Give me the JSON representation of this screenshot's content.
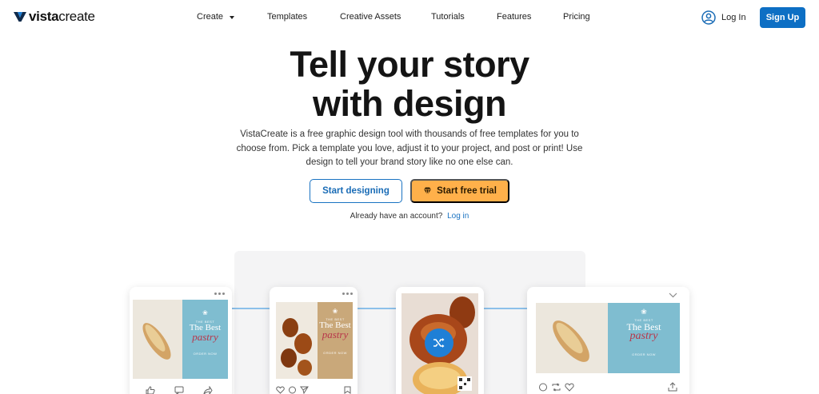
{
  "brand": {
    "logo_bold": "vista",
    "logo_rest": "create",
    "accent": "#0d6fc4",
    "orange": "#ffb04a"
  },
  "nav": {
    "items": [
      {
        "label": "Create"
      },
      {
        "label": "Templates"
      },
      {
        "label": "Creative Assets"
      },
      {
        "label": "Tutorials"
      },
      {
        "label": "Features"
      },
      {
        "label": "Pricing"
      }
    ],
    "login": "Log In",
    "signup": "Sign Up"
  },
  "hero": {
    "title_line1": "Tell your story",
    "title_line2": "with design",
    "description": "VistaCreate is a free graphic design tool with thousands of free templates for you to choose from. Pick a template you love, adjust it to your project, and post or print! Use design to tell your brand story like no one else can.",
    "cta_primary": "Start designing",
    "cta_secondary": "Start free trial",
    "already_text": "Already have an account?",
    "already_link": "Log in"
  },
  "showcase": {
    "card_title_small": "THE BEST",
    "card_title_big": "The Best",
    "card_title_script": "pastry",
    "card_footer_small": "ORDER NOW"
  }
}
